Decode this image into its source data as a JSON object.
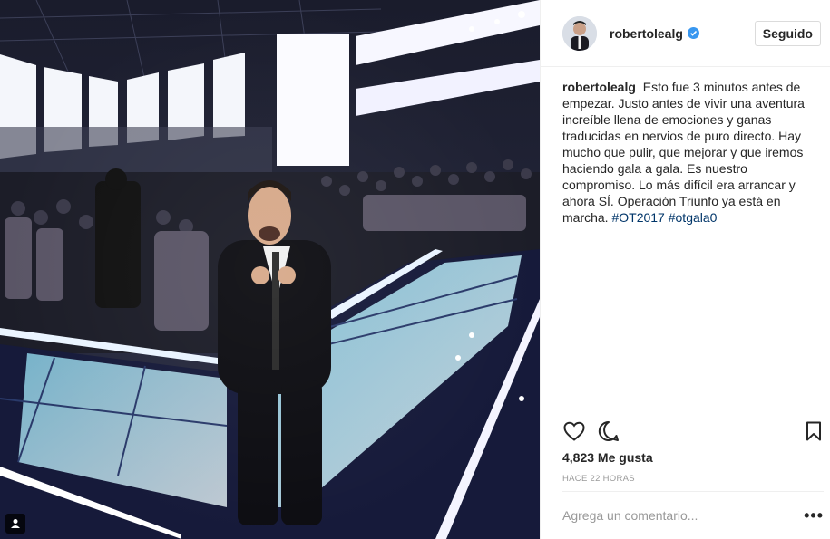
{
  "post": {
    "username": "robertolealg",
    "follow_label": "Seguido",
    "caption_user": "robertolealg",
    "caption_text": "Esto fue 3 minutos antes de empezar. Justo antes de vivir una aventura increíble llena de emociones y ganas traducidas en nervios de puro directo. Hay mucho que pulir, que mejorar y que iremos haciendo gala a gala. Es nuestro compromiso. Lo más difícil era arrancar y ahora SÍ. Operación Triunfo ya está en marcha.",
    "hashtags": [
      "#OT2017",
      "#otgala0"
    ],
    "likes": "4,823 Me gusta",
    "timestamp": "HACE 22 HORAS",
    "comment_placeholder": "Agrega un comentario...",
    "more_label": "•••"
  },
  "icons": {
    "verified": "verified-badge-icon",
    "like": "heart-icon",
    "comment": "comment-icon",
    "save": "bookmark-icon",
    "tagged": "person-tag-icon"
  },
  "colors": {
    "verified": "#3897f0",
    "hashtag": "#003569",
    "muted": "#999999",
    "text": "#262626"
  }
}
